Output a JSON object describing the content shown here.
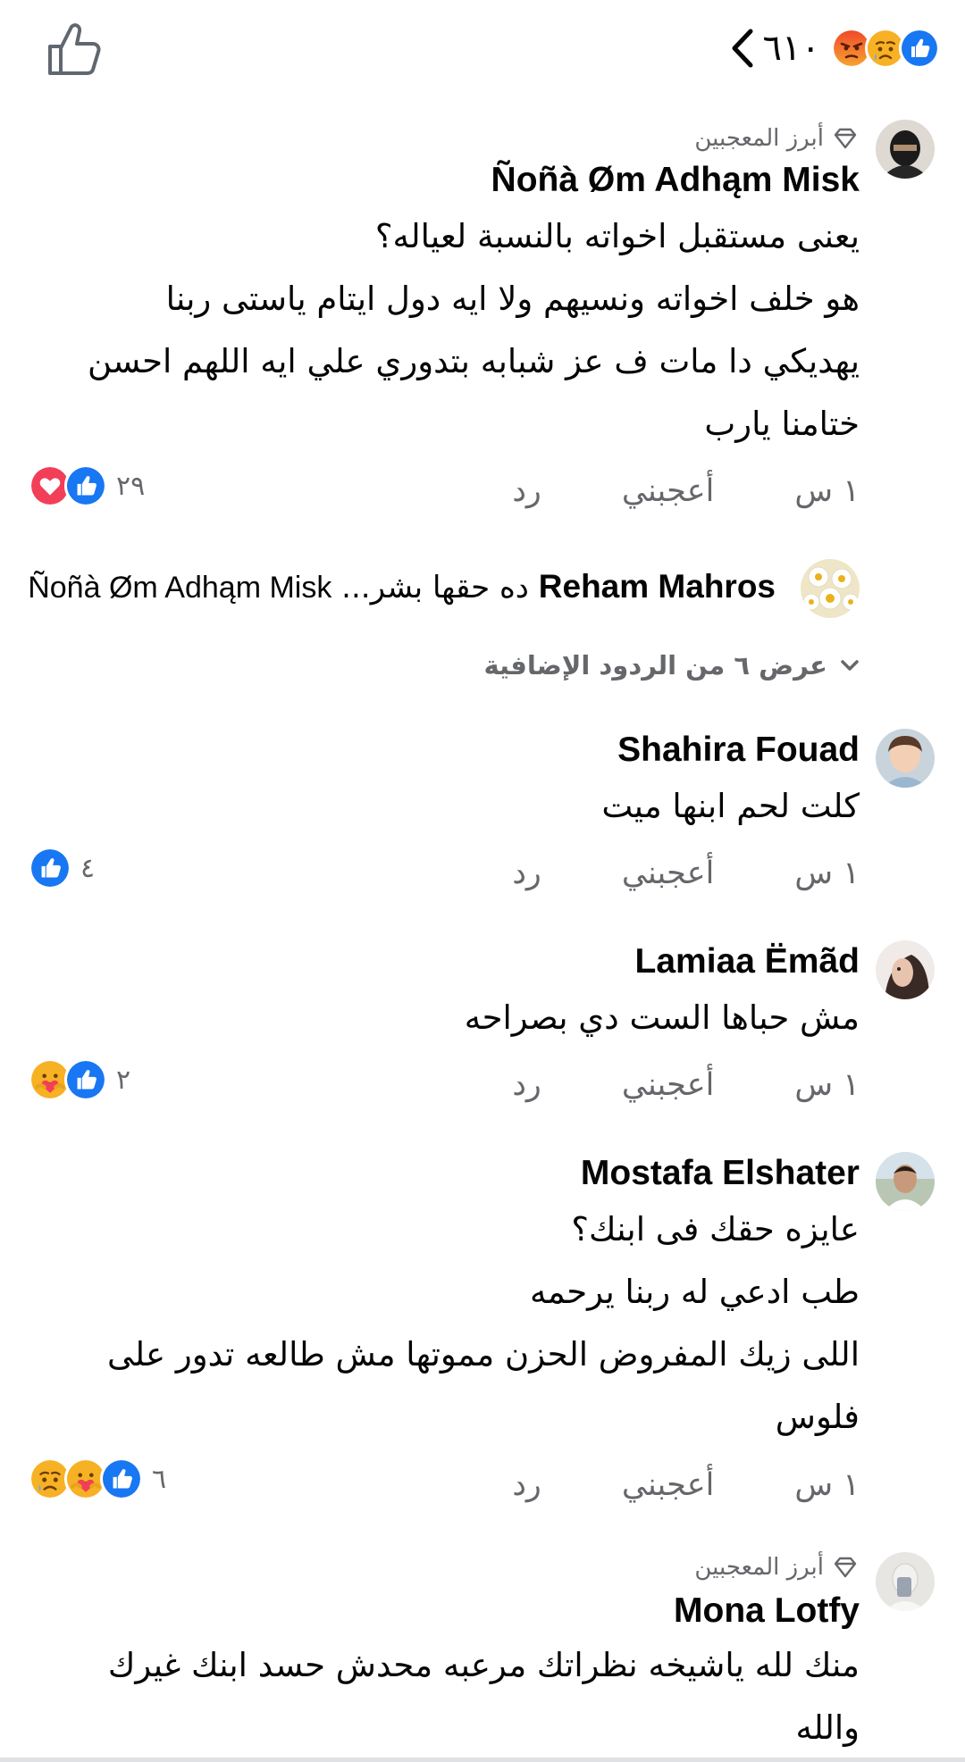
{
  "header": {
    "count": "٦١٠",
    "reactions": [
      "like-reaction",
      "sad-reaction",
      "angry-reaction"
    ]
  },
  "labels": {
    "top_fan": "أبرز المعجبين",
    "time": "١ س",
    "like": "أعجبني",
    "reply": "رد"
  },
  "comments": [
    {
      "author": "Ñoñà Øm Adhąm Misk",
      "top_fan": true,
      "lines": [
        "يعنى مستقبل اخواته بالنسبة لعياله؟",
        "هو خلف اخواته ونسيهم ولا ايه دول ايتام ياستى ربنا",
        "يهديكي دا مات ف عز شبابه بتدوري علي ايه اللهم احسن",
        "ختامنا يارب"
      ],
      "reaction_count": "٢٩",
      "reactions": [
        "like-reaction",
        "love-reaction"
      ]
    },
    {
      "author": "Shahira Fouad",
      "top_fan": false,
      "lines": [
        "كلت لحم ابنها ميت"
      ],
      "reaction_count": "٤",
      "reactions": [
        "like-reaction"
      ]
    },
    {
      "author": "Lamiaa Ëmãd",
      "top_fan": false,
      "lines": [
        "مش حباها الست دي بصراحه"
      ],
      "reaction_count": "٢",
      "reactions": [
        "like-reaction",
        "care-reaction"
      ]
    },
    {
      "author": "Mostafa Elshater",
      "top_fan": false,
      "lines": [
        "عايزه حقك فى ابنك؟",
        "طب ادعي له ربنا يرحمه",
        "اللى زيك المفروض الحزن مموتها مش طالعه تدور على",
        "فلوس"
      ],
      "reaction_count": "٦",
      "reactions": [
        "like-reaction",
        "care-reaction",
        "sad-reaction"
      ]
    },
    {
      "author": "Mona Lotfy",
      "top_fan": true,
      "lines": [
        "منك لله ياشيخه نظراتك مرعبه محدش حسد ابنك غيرك",
        "والله"
      ]
    }
  ],
  "reply_preview": {
    "author": "Reham Mahros",
    "text": "ده حقها بشر...",
    "mention": "Ñoñà Øm Adhąm Misk"
  },
  "more_replies": "عرض ٦ من الردود الإضافية",
  "colors": {
    "like_blue": "#1877f2",
    "love_red": "#f33e58",
    "angry_orange": "#e9710f",
    "sad_yellow": "#f7b125",
    "secondary_text": "#65676b"
  }
}
